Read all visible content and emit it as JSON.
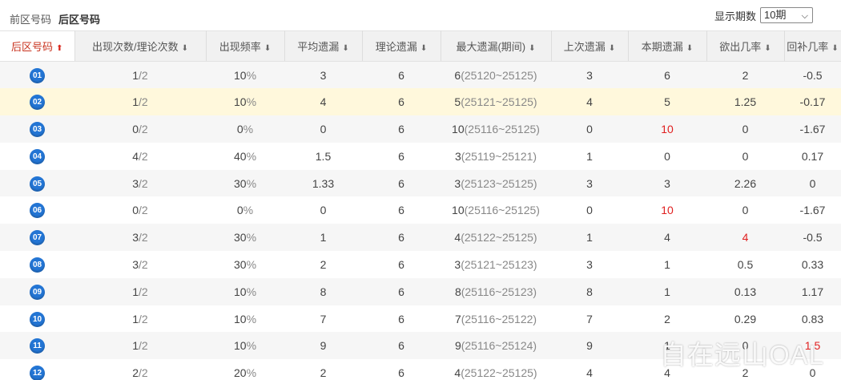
{
  "tabs": {
    "front": "前区号码",
    "back": "后区号码"
  },
  "period": {
    "label": "显示期数",
    "value": "10期"
  },
  "table": {
    "headers": [
      {
        "label": "后区号码",
        "active": true,
        "arrow": "⬆"
      },
      {
        "label": "出现次数/理论次数",
        "arrow": "⬇"
      },
      {
        "label": "出现频率",
        "arrow": "⬇"
      },
      {
        "label": "平均遗漏",
        "arrow": "⬇"
      },
      {
        "label": "理论遗漏",
        "arrow": "⬇"
      },
      {
        "label": "最大遗漏(期间)",
        "arrow": "⬇"
      },
      {
        "label": "上次遗漏",
        "arrow": "⬇"
      },
      {
        "label": "本期遗漏",
        "arrow": "⬇"
      },
      {
        "label": "欲出几率",
        "arrow": "⬇"
      },
      {
        "label": "回补几率",
        "arrow": "⬇"
      }
    ],
    "rows": [
      {
        "num": "01",
        "count": "1",
        "theory": "/2",
        "freq": "10",
        "freq_unit": "%",
        "avg": "3",
        "theo": "6",
        "max": "6",
        "max_range": "(25120~25125)",
        "last": "3",
        "cur": "6",
        "cur_red": false,
        "want": "2",
        "want_red": false,
        "back": "-0.5",
        "back_red": false
      },
      {
        "num": "02",
        "count": "1",
        "theory": "/2",
        "freq": "10",
        "freq_unit": "%",
        "avg": "4",
        "theo": "6",
        "max": "5",
        "max_range": "(25121~25125)",
        "last": "4",
        "cur": "5",
        "cur_red": false,
        "want": "1.25",
        "want_red": false,
        "back": "-0.17",
        "back_red": false
      },
      {
        "num": "03",
        "count": "0",
        "theory": "/2",
        "freq": "0",
        "freq_unit": "%",
        "avg": "0",
        "theo": "6",
        "max": "10",
        "max_range": "(25116~25125)",
        "last": "0",
        "cur": "10",
        "cur_red": true,
        "want": "0",
        "want_red": false,
        "back": "-1.67",
        "back_red": false
      },
      {
        "num": "04",
        "count": "4",
        "theory": "/2",
        "freq": "40",
        "freq_unit": "%",
        "avg": "1.5",
        "theo": "6",
        "max": "3",
        "max_range": "(25119~25121)",
        "last": "1",
        "cur": "0",
        "cur_red": false,
        "want": "0",
        "want_red": false,
        "back": "0.17",
        "back_red": false
      },
      {
        "num": "05",
        "count": "3",
        "theory": "/2",
        "freq": "30",
        "freq_unit": "%",
        "avg": "1.33",
        "theo": "6",
        "max": "3",
        "max_range": "(25123~25125)",
        "last": "3",
        "cur": "3",
        "cur_red": false,
        "want": "2.26",
        "want_red": false,
        "back": "0",
        "back_red": false
      },
      {
        "num": "06",
        "count": "0",
        "theory": "/2",
        "freq": "0",
        "freq_unit": "%",
        "avg": "0",
        "theo": "6",
        "max": "10",
        "max_range": "(25116~25125)",
        "last": "0",
        "cur": "10",
        "cur_red": true,
        "want": "0",
        "want_red": false,
        "back": "-1.67",
        "back_red": false
      },
      {
        "num": "07",
        "count": "3",
        "theory": "/2",
        "freq": "30",
        "freq_unit": "%",
        "avg": "1",
        "theo": "6",
        "max": "4",
        "max_range": "(25122~25125)",
        "last": "1",
        "cur": "4",
        "cur_red": false,
        "want": "4",
        "want_red": true,
        "back": "-0.5",
        "back_red": false
      },
      {
        "num": "08",
        "count": "3",
        "theory": "/2",
        "freq": "30",
        "freq_unit": "%",
        "avg": "2",
        "theo": "6",
        "max": "3",
        "max_range": "(25121~25123)",
        "last": "3",
        "cur": "1",
        "cur_red": false,
        "want": "0.5",
        "want_red": false,
        "back": "0.33",
        "back_red": false
      },
      {
        "num": "09",
        "count": "1",
        "theory": "/2",
        "freq": "10",
        "freq_unit": "%",
        "avg": "8",
        "theo": "6",
        "max": "8",
        "max_range": "(25116~25123)",
        "last": "8",
        "cur": "1",
        "cur_red": false,
        "want": "0.13",
        "want_red": false,
        "back": "1.17",
        "back_red": false
      },
      {
        "num": "10",
        "count": "1",
        "theory": "/2",
        "freq": "10",
        "freq_unit": "%",
        "avg": "7",
        "theo": "6",
        "max": "7",
        "max_range": "(25116~25122)",
        "last": "7",
        "cur": "2",
        "cur_red": false,
        "want": "0.29",
        "want_red": false,
        "back": "0.83",
        "back_red": false
      },
      {
        "num": "11",
        "count": "1",
        "theory": "/2",
        "freq": "10",
        "freq_unit": "%",
        "avg": "9",
        "theo": "6",
        "max": "9",
        "max_range": "(25116~25124)",
        "last": "9",
        "cur": "1",
        "cur_red": false,
        "want": "0",
        "want_red": false,
        "back": "1.5",
        "back_red": true
      },
      {
        "num": "12",
        "count": "2",
        "theory": "/2",
        "freq": "20",
        "freq_unit": "%",
        "avg": "2",
        "theo": "6",
        "max": "4",
        "max_range": "(25122~25125)",
        "last": "4",
        "cur": "4",
        "cur_red": false,
        "want": "2",
        "want_red": false,
        "back": "0",
        "back_red": false
      }
    ]
  },
  "watermark": "自在远山OAL",
  "colors": {
    "ball": "#2375d4",
    "highlight": "#fff8dc",
    "red": "#e02020",
    "active_header": "#c8321e"
  }
}
